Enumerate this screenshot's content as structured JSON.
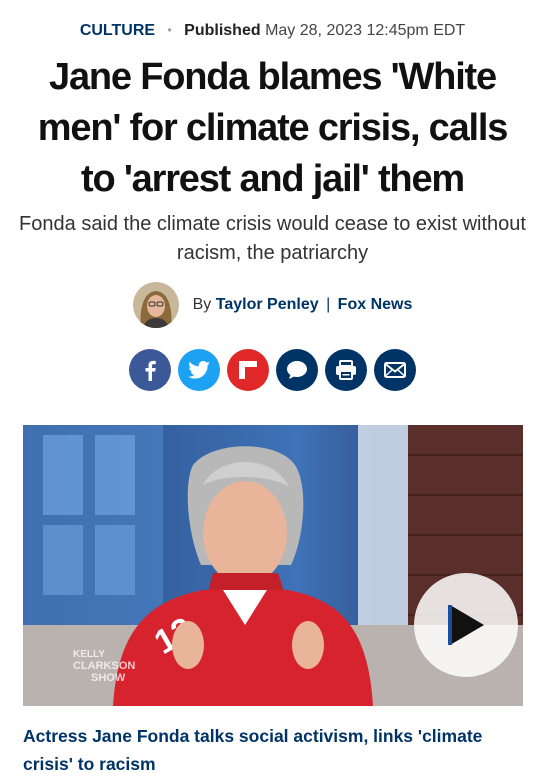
{
  "meta": {
    "category": "CULTURE",
    "separator": "•",
    "published_label": "Published",
    "published_date": "May 28, 2023 12:45pm EDT"
  },
  "article": {
    "headline": "Jane Fonda blames 'White men' for climate crisis, calls to 'arrest and jail' them",
    "subheadline": "Fonda said the climate crisis would cease to exist without racism, the patriarchy"
  },
  "byline": {
    "prefix": "By",
    "author": "Taylor Penley",
    "separator": "|",
    "outlet": "Fox News",
    "avatar_icon": "author-avatar"
  },
  "share": {
    "buttons": [
      {
        "name": "facebook",
        "icon": "facebook-icon",
        "color": "#3b5998"
      },
      {
        "name": "twitter",
        "icon": "twitter-icon",
        "color": "#1da1f2"
      },
      {
        "name": "flipboard",
        "icon": "flipboard-icon",
        "color": "#e12828"
      },
      {
        "name": "comments",
        "icon": "comment-icon",
        "color": "#003366"
      },
      {
        "name": "print",
        "icon": "print-icon",
        "color": "#003366"
      },
      {
        "name": "email",
        "icon": "email-icon",
        "color": "#003366"
      }
    ]
  },
  "video": {
    "play_icon": "play-icon",
    "watermark_line1": "KELLY",
    "watermark_line2": "CLARKSON",
    "watermark_line3": "SHOW",
    "jersey_number": "12",
    "caption": "Actress Jane Fonda talks social activism, links 'climate crisis' to racism"
  },
  "colors": {
    "brand_navy": "#003366",
    "facebook": "#3b5998",
    "twitter": "#1da1f2",
    "flipboard": "#e12828"
  }
}
